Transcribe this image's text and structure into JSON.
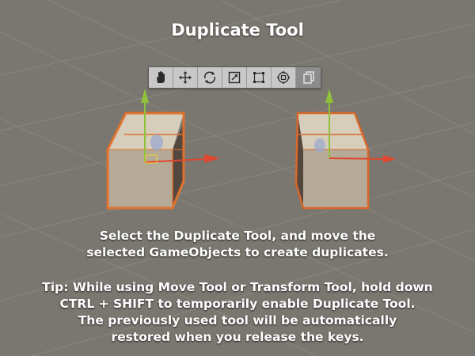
{
  "title": "Duplicate Tool",
  "toolbar": {
    "tools": [
      {
        "name": "hand-tool",
        "icon": "hand-icon",
        "active": false
      },
      {
        "name": "move-tool",
        "icon": "move-arrows-icon",
        "active": false
      },
      {
        "name": "rotate-tool",
        "icon": "rotate-icon",
        "active": false
      },
      {
        "name": "scale-tool",
        "icon": "scale-icon",
        "active": false
      },
      {
        "name": "rect-tool",
        "icon": "rect-transform-icon",
        "active": false
      },
      {
        "name": "transform-tool",
        "icon": "transform-icon",
        "active": false
      },
      {
        "name": "duplicate-tool",
        "icon": "duplicate-icon",
        "active": true
      }
    ]
  },
  "scene": {
    "selection_color": "#e0722e",
    "y_axis_color": "#8fc23a",
    "x_axis_color": "#e0472e"
  },
  "caption": {
    "line1": "Select the Duplicate Tool, and move the",
    "line2": "selected GameObjects to create duplicates.",
    "tip1": "Tip: While using Move Tool or Transform Tool, hold down",
    "tip2": "CTRL + SHIFT to temporarily enable Duplicate Tool.",
    "tip3": "The previously used tool will be automatically",
    "tip4": "restored when you release the keys."
  }
}
